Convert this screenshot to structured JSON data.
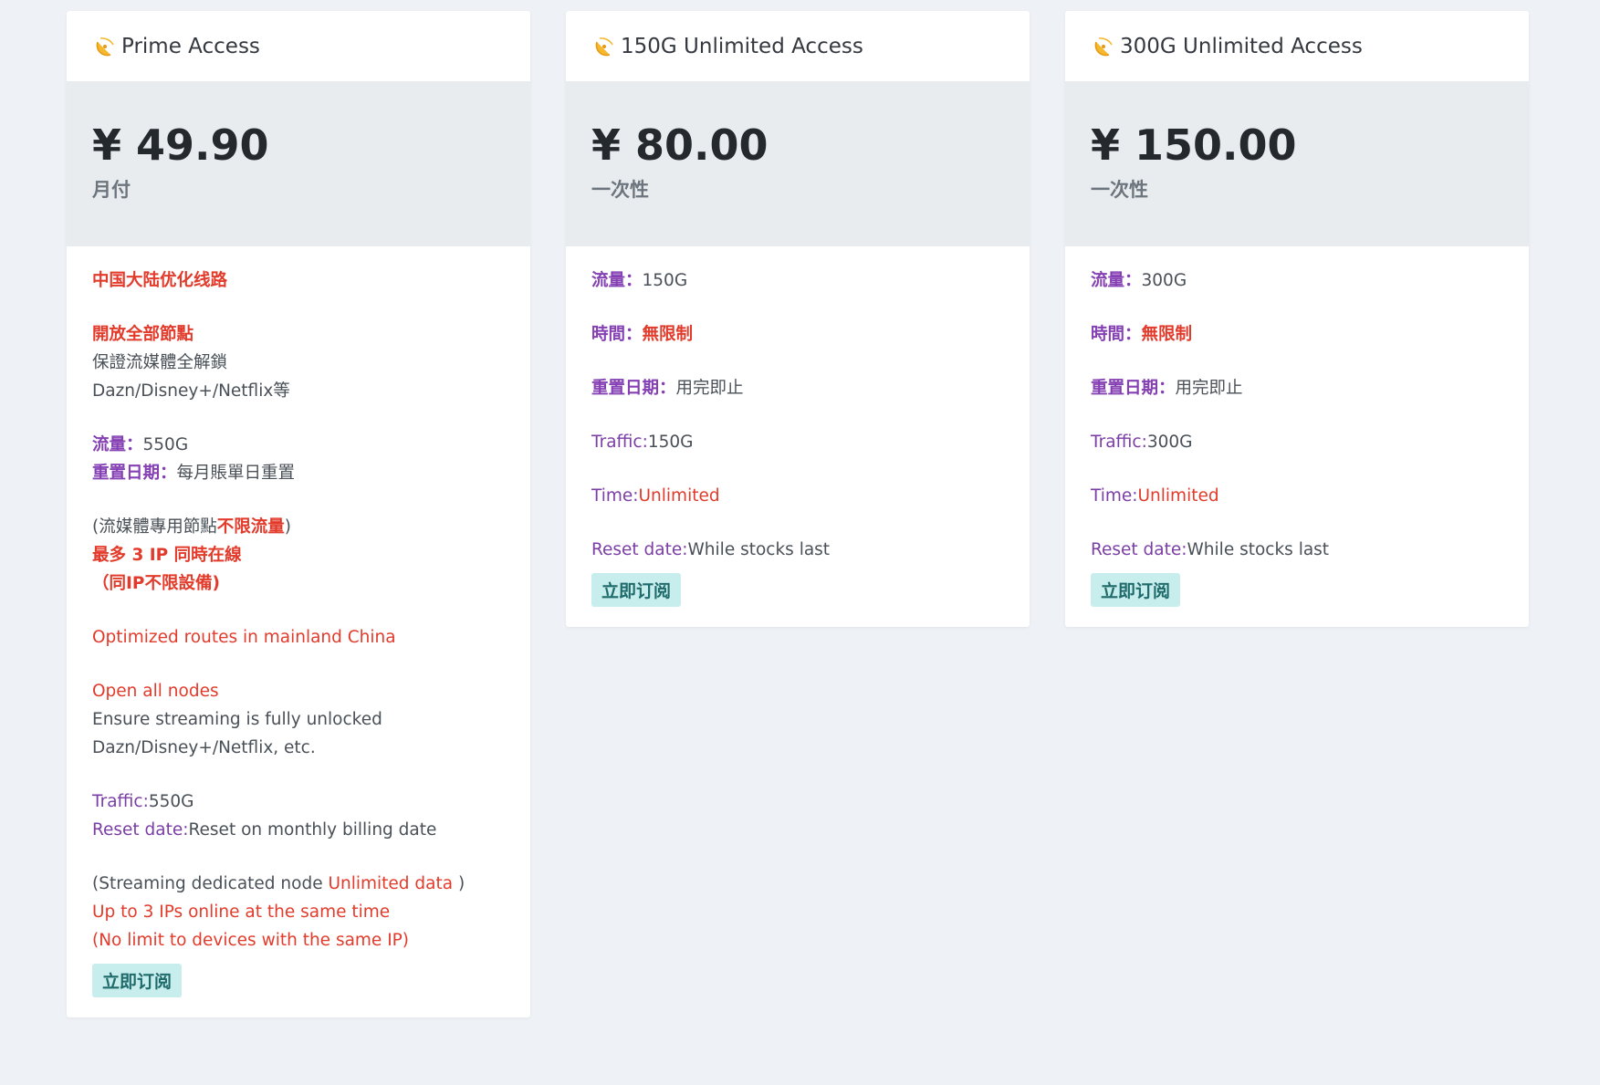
{
  "plans": [
    {
      "title": "Prime Access",
      "price": "¥ 49.90",
      "period": "月付",
      "desc": {
        "cn_route": "中国大陆优化线路",
        "cn_open": "開放全部節點",
        "cn_unlock": "保證流媒體全解鎖",
        "cn_services": "Dazn/Disney+/Netflix等",
        "cn_traffic_label": "流量：",
        "cn_traffic_value": "550G",
        "cn_reset_label": "重置日期：",
        "cn_reset_value": "每月賬單日重置",
        "cn_stream_a": "(流媒體專用節點",
        "cn_stream_b": "不限流量",
        "cn_stream_c": ")",
        "cn_ip": "最多 3 IP 同時在線",
        "cn_device": "（同IP不限設備)",
        "en_route": "Optimized routes in mainland China",
        "en_open": "Open all nodes",
        "en_unlock": "Ensure streaming is fully unlocked",
        "en_services": "Dazn/Disney+/Netflix, etc.",
        "en_traffic_label": "Traffic:",
        "en_traffic_value": "550G",
        "en_reset_label": "Reset date:",
        "en_reset_value": "Reset on monthly billing date",
        "en_stream_a": "(Streaming dedicated node ",
        "en_stream_b": "Unlimited data",
        "en_stream_c": " )",
        "en_ip": "Up to 3 IPs online at the same time",
        "en_device": "(No limit to devices with the same IP)"
      },
      "button": "立即订阅"
    },
    {
      "title": "150G Unlimited Access",
      "price": "¥ 80.00",
      "period": "一次性",
      "desc": {
        "cn_traffic_label": "流量：",
        "cn_traffic_value": "150G",
        "cn_time_label": "時間：",
        "cn_time_value": "無限制",
        "cn_reset_label": "重置日期：",
        "cn_reset_value": "用完即止",
        "en_traffic_label": "Traffic:",
        "en_traffic_value": "150G",
        "en_time_label": "Time:",
        "en_time_value": "Unlimited",
        "en_reset_label": "Reset date:",
        "en_reset_value": "While stocks last"
      },
      "button": "立即订阅"
    },
    {
      "title": "300G Unlimited Access",
      "price": "¥ 150.00",
      "period": "一次性",
      "desc": {
        "cn_traffic_label": "流量：",
        "cn_traffic_value": "300G",
        "cn_time_label": "時間：",
        "cn_time_value": "無限制",
        "cn_reset_label": "重置日期：",
        "cn_reset_value": "用完即止",
        "en_traffic_label": "Traffic:",
        "en_traffic_value": "300G",
        "en_time_label": "Time:",
        "en_time_value": "Unlimited",
        "en_reset_label": "Reset date:",
        "en_reset_value": "While stocks last"
      },
      "button": "立即订阅"
    }
  ],
  "icon": "satellite-dish-icon",
  "colors": {
    "accent_red": "#e23b2b",
    "label_purple": "#8540b3",
    "button_bg": "#c7eded",
    "price_bg": "#e9ecef"
  }
}
